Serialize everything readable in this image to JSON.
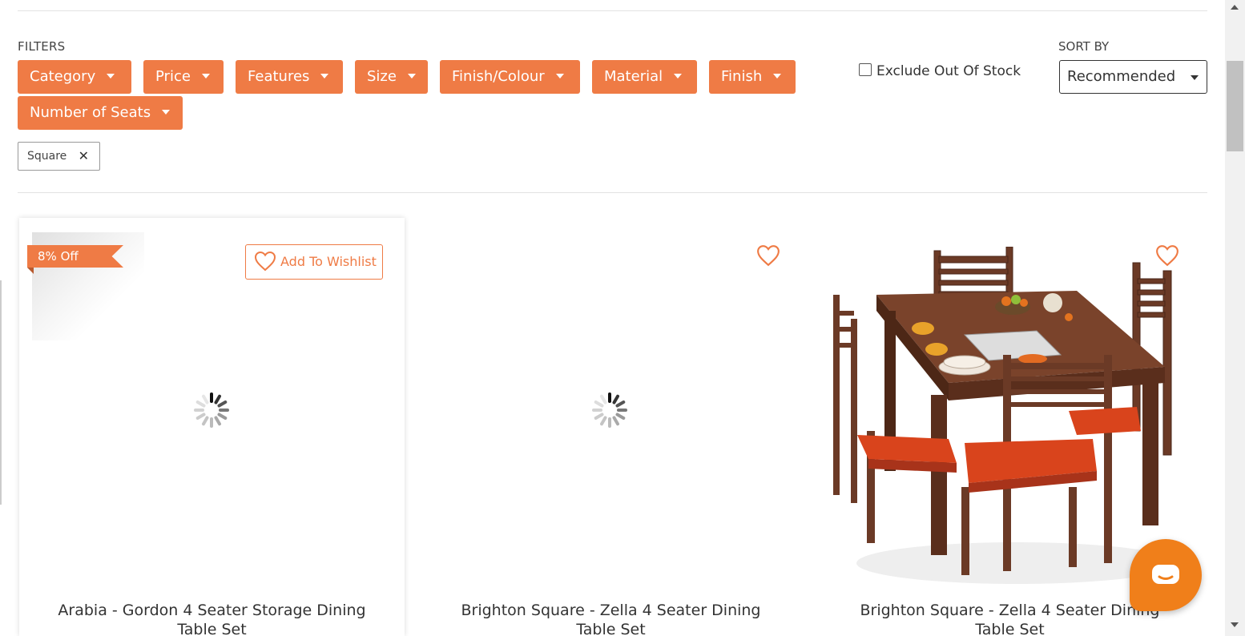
{
  "filters": {
    "label": "FILTERS",
    "buttons": [
      {
        "label": "Category"
      },
      {
        "label": "Price"
      },
      {
        "label": "Features"
      },
      {
        "label": "Size"
      },
      {
        "label": "Finish/Colour"
      },
      {
        "label": "Material"
      },
      {
        "label": "Finish"
      },
      {
        "label": "Number of Seats"
      }
    ],
    "applied": [
      {
        "label": "Square",
        "remove_icon": "close-icon"
      }
    ],
    "exclude_out_of_stock": {
      "label": "Exclude Out Of Stock",
      "checked": false
    }
  },
  "sort": {
    "label": "SORT BY",
    "selected": "Recommended"
  },
  "products": [
    {
      "title": "Arabia - Gordon 4 Seater Storage Dining Table Set",
      "discount": "8% Off",
      "wishlist_label": "Add To Wishlist",
      "image": "loading-spinner"
    },
    {
      "title": "Brighton Square - Zella 4 Seater Dining Table Set",
      "image": "loading-spinner",
      "wishlist_icon": "heart-icon"
    },
    {
      "title": "Brighton Square - Zella 4 Seater Dining Table Set",
      "image": "dining-set-photo",
      "wishlist_icon": "heart-icon"
    }
  ],
  "colors": {
    "accent": "#ef7b45",
    "chat": "#f07f1a",
    "text": "#333333"
  }
}
